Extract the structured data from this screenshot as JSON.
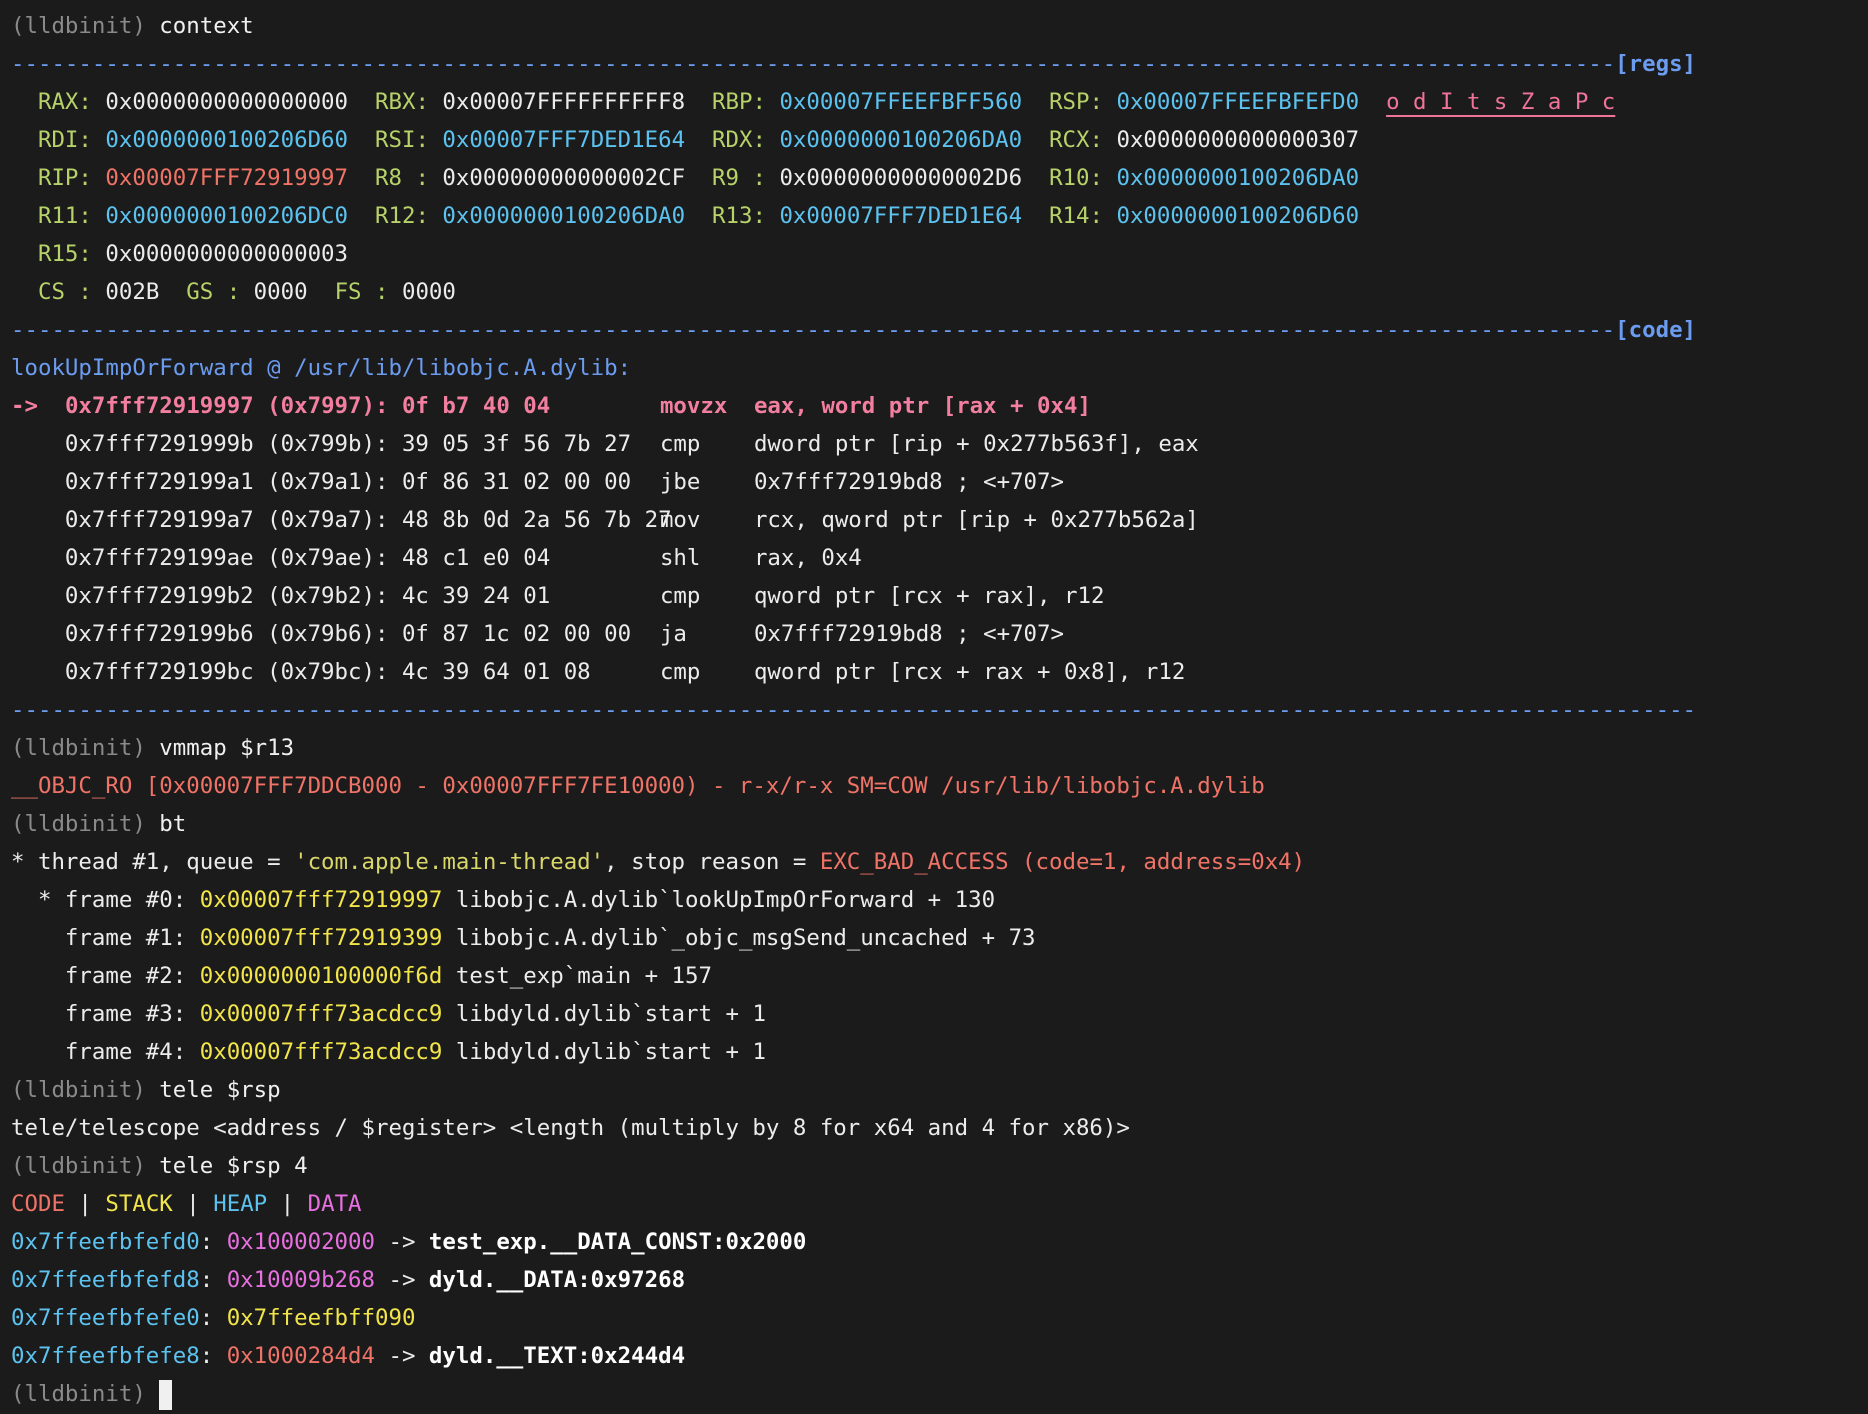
{
  "prompt": "(lldbinit)",
  "cmd_context": "context",
  "regs_tag": "[regs]",
  "code_tag": "[code]",
  "regs": {
    "row1": [
      {
        "name": "RAX:",
        "value": "0x0000000000000000",
        "color": "white"
      },
      {
        "name": "RBX:",
        "value": "0x00007FFFFFFFFFF8",
        "color": "white"
      },
      {
        "name": "RBP:",
        "value": "0x00007FFEEFBFF560",
        "color": "cyan"
      },
      {
        "name": "RSP:",
        "value": "0x00007FFEEFBFEFD0",
        "color": "cyan"
      }
    ],
    "flags": "o d I t s Z a P c",
    "row2": [
      {
        "name": "RDI:",
        "value": "0x0000000100206D60",
        "color": "cyan"
      },
      {
        "name": "RSI:",
        "value": "0x00007FFF7DED1E64",
        "color": "cyan"
      },
      {
        "name": "RDX:",
        "value": "0x0000000100206DA0",
        "color": "cyan"
      },
      {
        "name": "RCX:",
        "value": "0x0000000000000307",
        "color": "white"
      }
    ],
    "row3": [
      {
        "name": "RIP:",
        "value": "0x00007FFF72919997",
        "color": "red"
      },
      {
        "name": "R8 :",
        "value": "0x00000000000002CF",
        "color": "white"
      },
      {
        "name": "R9 :",
        "value": "0x00000000000002D6",
        "color": "white"
      },
      {
        "name": "R10:",
        "value": "0x0000000100206DA0",
        "color": "cyan"
      }
    ],
    "row4": [
      {
        "name": "R11:",
        "value": "0x0000000100206DC0",
        "color": "cyan"
      },
      {
        "name": "R12:",
        "value": "0x0000000100206DA0",
        "color": "cyan"
      },
      {
        "name": "R13:",
        "value": "0x00007FFF7DED1E64",
        "color": "cyan"
      },
      {
        "name": "R14:",
        "value": "0x0000000100206D60",
        "color": "cyan"
      }
    ],
    "r15_name": "R15:",
    "r15_value": "0x0000000000000003",
    "segs": [
      {
        "name": "CS :",
        "value": "002B"
      },
      {
        "name": "GS :",
        "value": "0000"
      },
      {
        "name": "FS :",
        "value": "0000"
      }
    ]
  },
  "code": {
    "function_header": "lookUpImpOrForward @ /usr/lib/libobjc.A.dylib:",
    "arrow": "->",
    "rows": [
      {
        "addr": "0x7fff72919997 (0x7997):",
        "bytes": "0f b7 40 04",
        "mnemonic": "movzx",
        "operands": "eax, word ptr [rax + 0x4]"
      },
      {
        "addr": "0x7fff7291999b (0x799b):",
        "bytes": "39 05 3f 56 7b 27",
        "mnemonic": "cmp",
        "operands": "dword ptr [rip + 0x277b563f], eax"
      },
      {
        "addr": "0x7fff729199a1 (0x79a1):",
        "bytes": "0f 86 31 02 00 00",
        "mnemonic": "jbe",
        "operands": "0x7fff72919bd8 ; <+707>"
      },
      {
        "addr": "0x7fff729199a7 (0x79a7):",
        "bytes": "48 8b 0d 2a 56 7b 27",
        "mnemonic": "mov",
        "operands": "rcx, qword ptr [rip + 0x277b562a]"
      },
      {
        "addr": "0x7fff729199ae (0x79ae):",
        "bytes": "48 c1 e0 04",
        "mnemonic": "shl",
        "operands": "rax, 0x4"
      },
      {
        "addr": "0x7fff729199b2 (0x79b2):",
        "bytes": "4c 39 24 01",
        "mnemonic": "cmp",
        "operands": "qword ptr [rcx + rax], r12"
      },
      {
        "addr": "0x7fff729199b6 (0x79b6):",
        "bytes": "0f 87 1c 02 00 00",
        "mnemonic": "ja",
        "operands": "0x7fff72919bd8 ; <+707>"
      },
      {
        "addr": "0x7fff729199bc (0x79bc):",
        "bytes": "4c 39 64 01 08",
        "mnemonic": "cmp",
        "operands": "qword ptr [rcx + rax + 0x8], r12"
      }
    ]
  },
  "cmd_vmmap": "vmmap $r13",
  "vmmap_result": "__OBJC_RO [0x00007FFF7DDCB000 - 0x00007FFF7FE10000) - r-x/r-x SM=COW /usr/lib/libobjc.A.dylib",
  "cmd_bt": "bt",
  "bt": {
    "thread_prefix": "* thread #1, queue = ",
    "queue": "'com.apple.main-thread'",
    "stop_prefix": ", stop reason = ",
    "stop_reason": "EXC_BAD_ACCESS (code=1, address=0x4)",
    "frames": [
      {
        "prefix": "  * frame #0: ",
        "addr": "0x00007fff72919997",
        "symbol": " libobjc.A.dylib`lookUpImpOrForward + 130"
      },
      {
        "prefix": "    frame #1: ",
        "addr": "0x00007fff72919399",
        "symbol": " libobjc.A.dylib`_objc_msgSend_uncached + 73"
      },
      {
        "prefix": "    frame #2: ",
        "addr": "0x0000000100000f6d",
        "symbol": " test_exp`main + 157"
      },
      {
        "prefix": "    frame #3: ",
        "addr": "0x00007fff73acdcc9",
        "symbol": " libdyld.dylib`start + 1"
      },
      {
        "prefix": "    frame #4: ",
        "addr": "0x00007fff73acdcc9",
        "symbol": " libdyld.dylib`start + 1"
      }
    ]
  },
  "cmd_tele1": "tele $rsp",
  "tele_usage": "tele/telescope <address / $register> <length (multiply by 8 for x64 and 4 for x86)>",
  "cmd_tele2": "tele $rsp 4",
  "legend": {
    "code": "CODE",
    "stack": "STACK",
    "heap": "HEAP",
    "data": "DATA",
    "sep": " | "
  },
  "tele_rows": [
    {
      "addr": "0x7ffeefbfefd0",
      "value": "0x100002000",
      "value_color": "magenta",
      "arrow": " -> ",
      "target": "test_exp.__DATA_CONST:0x2000"
    },
    {
      "addr": "0x7ffeefbfefd8",
      "value": "0x10009b268",
      "value_color": "magenta",
      "arrow": " -> ",
      "target": "dyld.__DATA:0x97268"
    },
    {
      "addr": "0x7ffeefbfefe0",
      "value": "0x7ffeefbff090",
      "value_color": "yellow",
      "arrow": "",
      "target": ""
    },
    {
      "addr": "0x7ffeefbfefe8",
      "value": "0x1000284d4",
      "value_color": "red",
      "arrow": " -> ",
      "target": "dyld.__TEXT:0x244d4"
    }
  ]
}
